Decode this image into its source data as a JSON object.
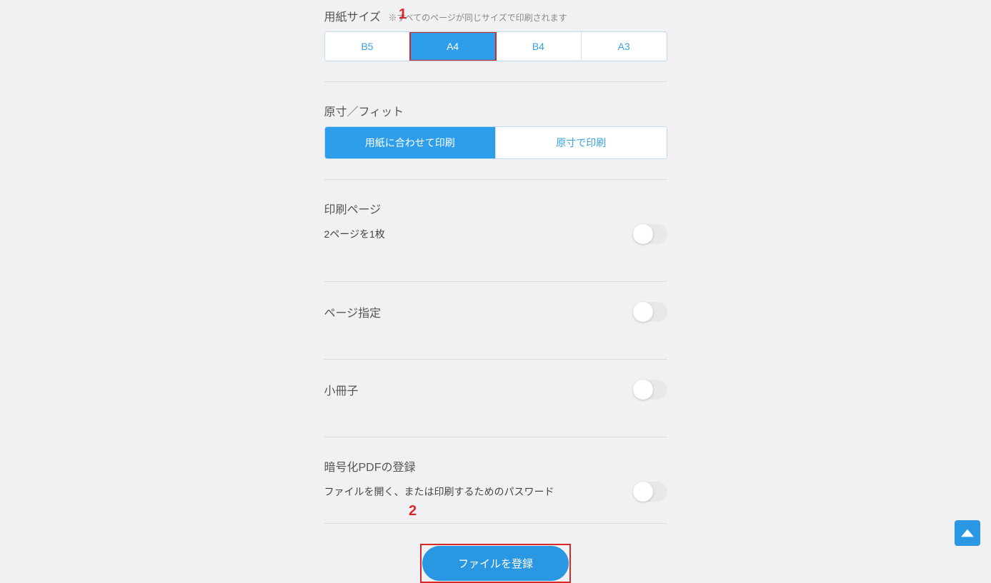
{
  "paperSize": {
    "title": "用紙サイズ",
    "note": "※すべてのページが同じサイズで印刷されます",
    "options": [
      "B5",
      "A4",
      "B4",
      "A3"
    ],
    "selected": "A4"
  },
  "fitMode": {
    "title": "原寸／フィット",
    "options": [
      "用紙に合わせて印刷",
      "原寸で印刷"
    ],
    "selected": "用紙に合わせて印刷"
  },
  "printPages": {
    "title": "印刷ページ",
    "label": "2ページを1枚"
  },
  "pageSpec": {
    "title": "ページ指定"
  },
  "booklet": {
    "title": "小冊子"
  },
  "encryptedPdf": {
    "title": "暗号化PDFの登録",
    "label": "ファイルを開く、または印刷するためのパスワード"
  },
  "registerButton": {
    "label": "ファイルを登録"
  },
  "annotations": {
    "one": "1",
    "two": "2"
  }
}
